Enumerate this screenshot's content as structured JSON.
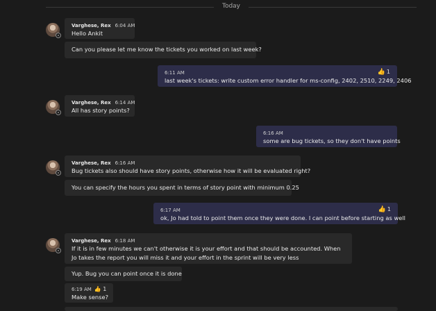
{
  "divider_label": "Today",
  "participant": "Varghese, Rex",
  "reaction_glyph": "👍",
  "m1": {
    "time": "6:04 AM",
    "text": "Hello Ankit",
    "follow": "Can you please let me know the tickets you worked on last week?"
  },
  "m2": {
    "time": "6:11 AM",
    "text": "last week's tickets: write custom error handler for ms-config, 2402, 2510, 2249, 2406",
    "reactions": "1"
  },
  "m3": {
    "time": "6:14 AM",
    "text": "All has story points?"
  },
  "m4": {
    "time": "6:16 AM",
    "text": "some are bug tickets, so they don't have points"
  },
  "m5": {
    "time": "6:16 AM",
    "text": "Bug tickets also should have story points, otherwise how it will be evaluated right?",
    "follow": "You can specify the hours you spent in terms of story point with minimum 0.25"
  },
  "m6": {
    "time": "6:17 AM",
    "text": "ok, Jo had told to point them once they were done. I can point before starting as well",
    "reactions": "1"
  },
  "m7": {
    "time": "6:18 AM",
    "text": "If it is in few minutes we can't otherwise it is your effort and that should be accounted. When Jo takes the report you will miss it and your effort in the sprint will be very less",
    "follow": "Yup. Bug you can point once it is done",
    "follow2_time": "6:19 AM",
    "follow2_reactions": "1",
    "follow2_text": "Make sense?"
  }
}
